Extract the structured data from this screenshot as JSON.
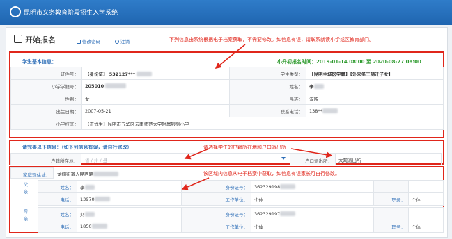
{
  "header": {
    "title": "昆明市义务教育阶段招生入学系统"
  },
  "page": {
    "title": "开始报名",
    "change_password": "修改密码",
    "logout": "注销"
  },
  "notes": {
    "top": "下列信息由系统根据电子档案获取，不需要修改。如信息有误，请联系就读小学或区教育部门。",
    "middle": "请选择学生的户籍所在地和户口派出所",
    "bottom": "该区域内信息从电子档案中获取，如信息有误家长可自行修改。"
  },
  "student": {
    "section_title": "学生基本信息：",
    "enroll_time": "小升初报名时间：2019-01-14 08:00 至 2020-08-27 08:00",
    "rows": [
      [
        "证件号：",
        "【身份证】 532127***",
        "学生类型：",
        "【昆明主城区学籍】【外来务工随迁子女】"
      ],
      [
        "小学学籍号：",
        "205010",
        "姓名：",
        "李"
      ],
      [
        "性别：",
        "女",
        "民族：",
        "汉族"
      ],
      [
        "出生日期：",
        "2007-05-21",
        "联系电话：",
        "138**"
      ]
    ],
    "school_label": "小学校区：",
    "school_value": "【正式生】昆明市五华区云南师范大学附属银剑小学"
  },
  "household": {
    "section_title": "请完善以下信息：（如下列信息有误，请自行修改）",
    "location_label": "户籍所在地：",
    "location_placeholder": "省 / 州 / 县",
    "police_label": "户口派出所：",
    "police_value": "大观派出所"
  },
  "family": {
    "address_label": "家庭现住址：",
    "address_value": "龙翔街道人民西路",
    "father_side": "父亲",
    "mother_side": "母亲",
    "father": [
      [
        "姓名：",
        "李",
        "身份证号：",
        "362329198",
        "",
        ""
      ],
      [
        "电话：",
        "13970",
        "工作单位：",
        "个体",
        "职务：",
        "个体"
      ]
    ],
    "mother": [
      [
        "姓名：",
        "刘",
        "身份证号：",
        "362329197",
        "",
        ""
      ],
      [
        "电话：",
        "1850",
        "工作单位：",
        "个体",
        "职务：",
        "个体"
      ]
    ]
  }
}
